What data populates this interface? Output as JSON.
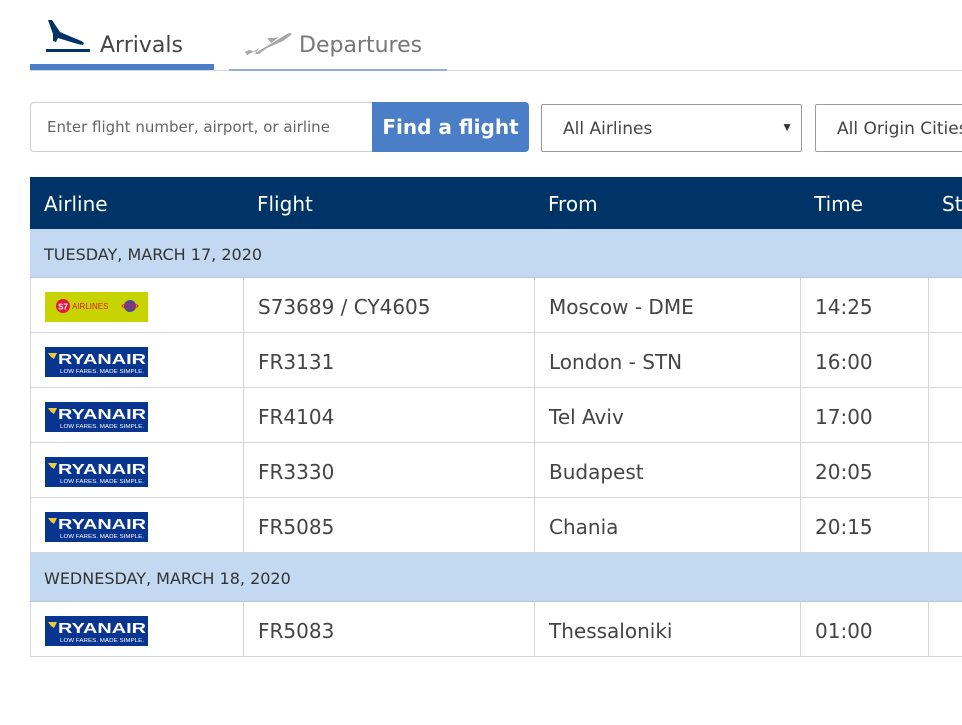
{
  "tabs": [
    {
      "label": "Arrivals",
      "active": true,
      "icon": "plane-landing-icon"
    },
    {
      "label": "Departures",
      "active": false,
      "icon": "plane-takeoff-icon"
    }
  ],
  "search": {
    "placeholder": "Enter flight number, airport, or airline",
    "button_label": "Find a flight"
  },
  "filters": {
    "airlines": {
      "selected": "All Airlines"
    },
    "origin": {
      "selected": "All Origin Cities"
    }
  },
  "table": {
    "headers": [
      "Airline",
      "Flight",
      "From",
      "Time",
      "Status"
    ],
    "groups": [
      {
        "date": "TUESDAY, MARCH 17, 2020",
        "rows": [
          {
            "airline": "S7 Airlines",
            "logo": "s7",
            "logo_text": "AIRLINES",
            "flight": "S73689 / CY4605",
            "from": "Moscow - DME",
            "time": "14:25"
          },
          {
            "airline": "Ryanair",
            "logo": "ryanair",
            "logo_text": "RYANAIR",
            "logo_sub": "LOW FARES. MADE SIMPLE.",
            "flight": "FR3131",
            "from": "London - STN",
            "time": "16:00"
          },
          {
            "airline": "Ryanair",
            "logo": "ryanair",
            "logo_text": "RYANAIR",
            "logo_sub": "LOW FARES. MADE SIMPLE.",
            "flight": "FR4104",
            "from": "Tel Aviv",
            "time": "17:00"
          },
          {
            "airline": "Ryanair",
            "logo": "ryanair",
            "logo_text": "RYANAIR",
            "logo_sub": "LOW FARES. MADE SIMPLE.",
            "flight": "FR3330",
            "from": "Budapest",
            "time": "20:05"
          },
          {
            "airline": "Ryanair",
            "logo": "ryanair",
            "logo_text": "RYANAIR",
            "logo_sub": "LOW FARES. MADE SIMPLE.",
            "flight": "FR5085",
            "from": "Chania",
            "time": "20:15"
          }
        ]
      },
      {
        "date": "WEDNESDAY, MARCH 18, 2020",
        "rows": [
          {
            "airline": "Ryanair",
            "logo": "ryanair",
            "logo_text": "RYANAIR",
            "logo_sub": "LOW FARES. MADE SIMPLE.",
            "flight": "FR5083",
            "from": "Thessaloniki",
            "time": "01:00"
          }
        ]
      }
    ]
  },
  "colors": {
    "accent": "#4a7ec7",
    "header_bg": "#003466",
    "date_row_bg": "#c3d8f1",
    "ryanair_bg": "#073590",
    "s7_bg": "#c8d400"
  }
}
